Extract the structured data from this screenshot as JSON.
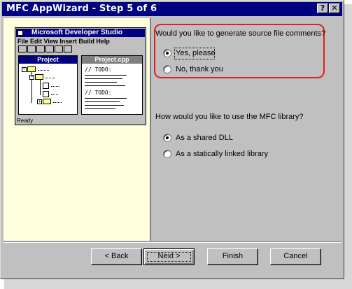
{
  "window": {
    "title": "MFC AppWizard - Step 5 of 6",
    "help_button": "?",
    "close_button": "✕"
  },
  "preview": {
    "app_title": "Microsoft Developer Studio",
    "menu": "File Edit View Insert Build Help",
    "project_pane_title": "Project",
    "file_pane_title": "Project.cpp",
    "todo_1": "// TODO:",
    "todo_2": "// TODO:",
    "status": "Ready"
  },
  "comments": {
    "question": "Would you like to generate source file comments?",
    "options": [
      {
        "label": "Yes, please",
        "selected": true
      },
      {
        "label": "No, thank you",
        "selected": false
      }
    ]
  },
  "library": {
    "question": "How would you like to use the MFC library?",
    "options": [
      {
        "label": "As a shared DLL",
        "selected": true
      },
      {
        "label": "As a statically linked library",
        "selected": false
      }
    ]
  },
  "buttons": {
    "back": "< Back",
    "next": "Next >",
    "finish": "Finish",
    "cancel": "Cancel"
  },
  "colors": {
    "titlebar": "#000080",
    "panel": "#ffffe0",
    "highlight": "#e02020"
  }
}
